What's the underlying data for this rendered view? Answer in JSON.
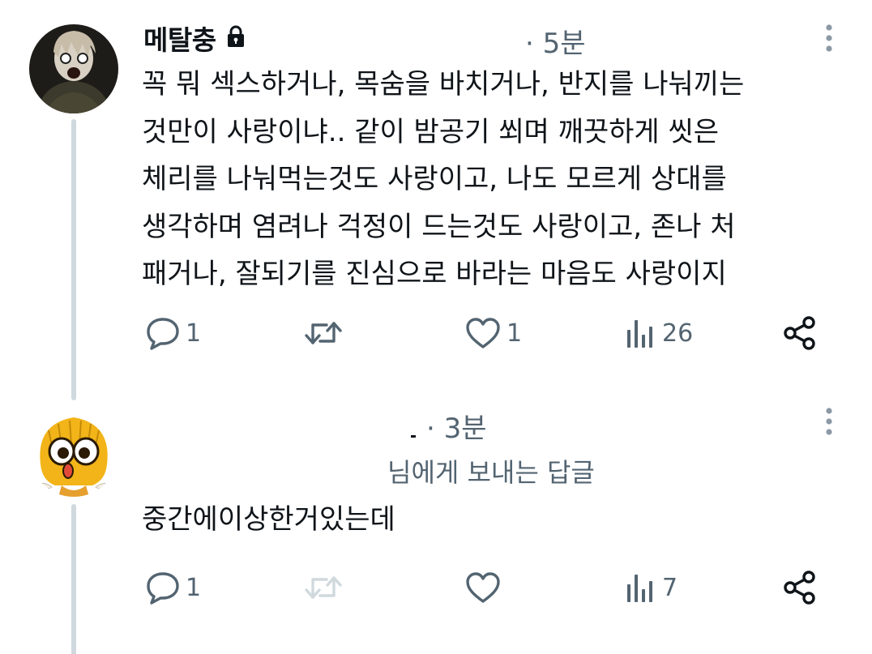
{
  "tweets": [
    {
      "display_name": "메탈충",
      "protected": true,
      "time": "· 5분",
      "text": "꼭 뭐 섹스하거나, 목숨을 바치거나, 반지를 나눠끼는\n것만이 사랑이냐.. 같이 밤공기 쐬며 깨끗하게 씻은\n체리를 나눠먹는것도 사랑이고, 나도 모르게 상대를\n생각하며 염려나 걱정이 드는것도 사랑이고, 존나 처\n패거나, 잘되기를 진심으로 바라는 마음도 사랑이지",
      "actions": {
        "replies": "1",
        "retweets": "",
        "likes": "1",
        "views": "26"
      }
    },
    {
      "display_name": "",
      "time": "· 3분",
      "replying_to": "님에게 보내는 답글",
      "text": "중간에이상한거있는데",
      "actions": {
        "replies": "1",
        "retweets": "",
        "likes": "",
        "views": "7"
      }
    }
  ],
  "icons": {
    "lock": "lock-icon",
    "more": "more-vertical-icon",
    "reply": "reply-bubble-icon",
    "retweet": "retweet-icon",
    "like": "heart-icon",
    "views": "views-bar-chart-icon",
    "share": "share-icon"
  },
  "colors": {
    "text": "#0f1419",
    "secondary": "#536471",
    "thread_line": "#cfd9de",
    "link_blue": "#1d9bf0"
  }
}
